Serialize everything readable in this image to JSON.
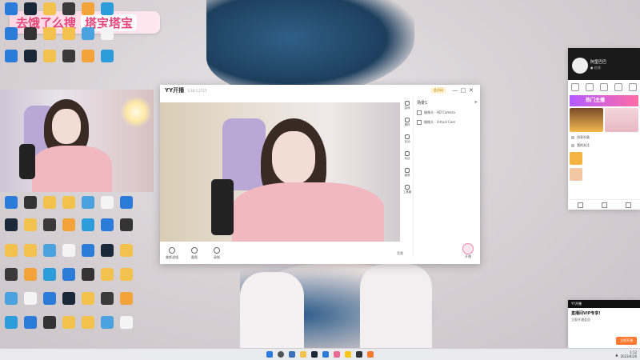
{
  "badge": {
    "text1": "去饿了么搜",
    "text2": "塔宝塔宝"
  },
  "colors": {
    "badge_text": "#e2467a",
    "accent_orange": "#ff7a2f",
    "stream_pink": "#f2b8c0"
  },
  "desktop_icons": [
    {
      "name": "wallet",
      "label": "",
      "color": "#2b7bd9"
    },
    {
      "name": "steam",
      "label": "",
      "color": "#1b2838"
    },
    {
      "name": "folder",
      "label": "",
      "color": "#f2c14e"
    },
    {
      "name": "game-app",
      "label": "",
      "color": "#3a3a3a"
    },
    {
      "name": "owl",
      "label": "",
      "color": "#f2a33a"
    },
    {
      "name": "pics",
      "label": "",
      "color": "#2d9cdb"
    },
    {
      "name": "display",
      "label": "",
      "color": "#2b7bd9"
    },
    {
      "name": "obs",
      "label": "",
      "color": "#333"
    },
    {
      "name": "folder2",
      "label": "",
      "color": "#f2c14e"
    },
    {
      "name": "folder3",
      "label": "",
      "color": "#f2c14e"
    },
    {
      "name": "bars",
      "label": "",
      "color": "#4aa3df"
    },
    {
      "name": "doc",
      "label": "",
      "color": "#f4f4f4"
    }
  ],
  "yy": {
    "logo": "YY开播",
    "version": "3.18.5.2727",
    "member": "会员码",
    "minimize": "—",
    "maximize": "□",
    "close": "✕",
    "side_tabs": [
      "游戏",
      "素材",
      "互动",
      "玩法",
      "道具",
      "工具箱"
    ],
    "scene_title": "场景1",
    "scene_add": "+",
    "scene_rows": [
      "摄像头 · HD Camera",
      "摄像头 · Virtual Cam"
    ],
    "tools": [
      "美颜滤镜",
      "截图",
      "录制"
    ],
    "audio_label": "音频",
    "live_label": "开播"
  },
  "right_panel": {
    "name": "阿里巴巴",
    "sub": "● 在线",
    "banner": "热门主播",
    "items": [
      "消息列表",
      "我的关注"
    ]
  },
  "notification": {
    "app": "YY开播",
    "title": "直播间VIP专享!",
    "body": "立即开通会员",
    "button": "立即开通"
  },
  "taskbar": {
    "time": "1:12",
    "date": "2023/4/26"
  }
}
